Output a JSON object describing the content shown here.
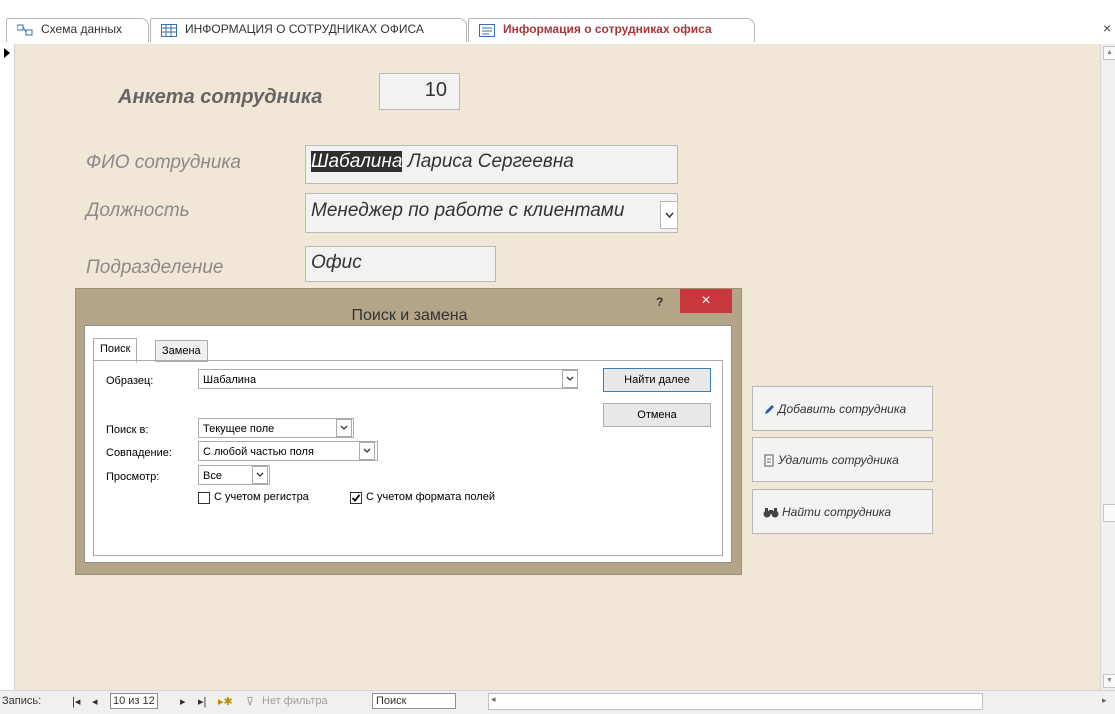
{
  "tabs": [
    {
      "label": "Схема данных",
      "icon": "relationships-icon"
    },
    {
      "label": "ИНФОРМАЦИЯ О СОТРУДНИКАХ ОФИСА",
      "icon": "table-icon"
    },
    {
      "label": "Информация о сотрудниках офиса",
      "icon": "form-icon"
    }
  ],
  "tab_close": "×",
  "form": {
    "title": "Анкета сотрудника",
    "record_id": "10",
    "fio_label": "ФИО сотрудника",
    "fio_highlight": "Шабалина",
    "fio_rest": " Лариса Сергеевна",
    "position_label": "Должность",
    "position_value": "Менеджер по работе с клиентами",
    "dept_label": "Подразделение",
    "dept_value": "Офис"
  },
  "side_buttons": [
    {
      "label": "Добавить сотрудника",
      "icon": "pencil-icon"
    },
    {
      "label": "Удалить сотрудника",
      "icon": "trash-icon"
    },
    {
      "label": "Найти сотрудника",
      "icon": "binoculars-icon"
    }
  ],
  "dialog": {
    "title": "Поиск и замена",
    "help": "?",
    "close": "×",
    "tabs": [
      "Поиск",
      "Замена"
    ],
    "pattern_label": "Образец:",
    "pattern_value": "Шабалина",
    "find_next": "Найти далее",
    "cancel": "Отмена",
    "search_in_label": "Поиск в:",
    "search_in_value": "Текущее поле",
    "match_label": "Совпадение:",
    "match_value": "С любой частью поля",
    "view_label": "Просмотр:",
    "view_value": "Все",
    "match_case_label": "С учетом регистра",
    "match_case_checked": false,
    "format_label": "С учетом формата полей",
    "format_checked": true
  },
  "statusbar": {
    "record_label": "Запись:",
    "record_value": "10 из 12",
    "filter": "Нет фильтра",
    "search": "Поиск"
  },
  "colors": {
    "form_bg": "#f1e7d6",
    "dialog_frame": "#b4a488",
    "close_red": "#c9383c",
    "active_tab_text": "#a4373a"
  }
}
